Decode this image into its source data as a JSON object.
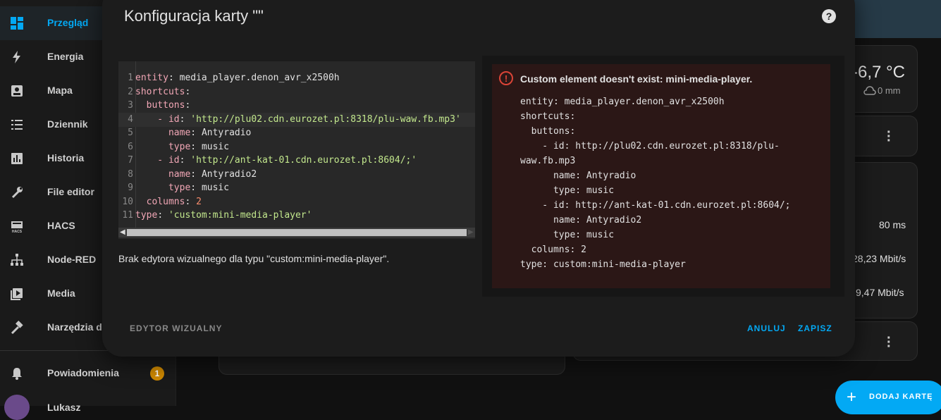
{
  "sidebar": {
    "items": [
      {
        "label": "Przegląd",
        "icon": "dashboard-icon"
      },
      {
        "label": "Energia",
        "icon": "lightning-icon"
      },
      {
        "label": "Mapa",
        "icon": "map-icon"
      },
      {
        "label": "Dziennik",
        "icon": "list-icon"
      },
      {
        "label": "Historia",
        "icon": "chart-icon"
      },
      {
        "label": "File editor",
        "icon": "wrench-icon"
      },
      {
        "label": "HACS",
        "icon": "hacs-icon"
      },
      {
        "label": "Node-RED",
        "icon": "sitemap-icon"
      },
      {
        "label": "Media",
        "icon": "play-icon"
      },
      {
        "label": "Narzędzia de",
        "icon": "hammer-icon"
      }
    ],
    "notifications": {
      "label": "Powiadomienia",
      "count": "1",
      "icon": "bell-icon"
    },
    "user": {
      "label": "Lukasz"
    }
  },
  "background": {
    "temperature": "-6,7 °C",
    "precipitation": "0 mm",
    "ping": "80 ms",
    "download": "28,23 Mbit/s",
    "upload": "9,47 Mbit/s",
    "add_card_label": "DODAJ KARTĘ"
  },
  "dialog": {
    "title": "Konfiguracja karty \"\"",
    "help_icon": "?",
    "editor_lines": [
      {
        "n": "1",
        "key": "entity",
        "val": "media_player.denon_avr_x2500h",
        "vtype": "t",
        "indent": ""
      },
      {
        "n": "2",
        "key": "shortcuts",
        "val": "",
        "vtype": "t",
        "indent": ""
      },
      {
        "n": "3",
        "key": "buttons",
        "val": "",
        "vtype": "t",
        "indent": "  "
      },
      {
        "n": "4",
        "key": "id",
        "val": "'http://plu02.cdn.eurozet.pl:8318/plu-waw.fb.mp3'",
        "vtype": "s",
        "indent": "    - "
      },
      {
        "n": "5",
        "key": "name",
        "val": "Antyradio",
        "vtype": "t",
        "indent": "      "
      },
      {
        "n": "6",
        "key": "type",
        "val": "music",
        "vtype": "t",
        "indent": "      "
      },
      {
        "n": "7",
        "key": "id",
        "val": "'http://ant-kat-01.cdn.eurozet.pl:8604/;'",
        "vtype": "s",
        "indent": "    - "
      },
      {
        "n": "8",
        "key": "name",
        "val": "Antyradio2",
        "vtype": "t",
        "indent": "      "
      },
      {
        "n": "9",
        "key": "type",
        "val": "music",
        "vtype": "t",
        "indent": "      "
      },
      {
        "n": "10",
        "key": "columns",
        "val": "2",
        "vtype": "n",
        "indent": "  "
      },
      {
        "n": "11",
        "key": "type",
        "val": "'custom:mini-media-player'",
        "vtype": "s",
        "indent": ""
      }
    ],
    "no_visual_editor": "Brak edytora wizualnego dla typu \"custom:mini-media-player\".",
    "error": {
      "title": "Custom element doesn't exist: mini-media-player.",
      "lines": [
        "entity: media_player.denon_avr_x2500h",
        "shortcuts:",
        "  buttons:",
        "    - id: http://plu02.cdn.eurozet.pl:8318/plu-",
        "waw.fb.mp3",
        "      name: Antyradio",
        "      type: music",
        "    - id: http://ant-kat-01.cdn.eurozet.pl:8604/;",
        "      name: Antyradio2",
        "      type: music",
        "  columns: 2",
        "type: custom:mini-media-player"
      ]
    },
    "buttons": {
      "visual_editor": "EDYTOR WIZUALNY",
      "cancel": "ANULUJ",
      "save": "ZAPISZ"
    }
  },
  "colors": {
    "accent": "#03a9f4",
    "error": "#db4437",
    "badge": "#d08a00"
  }
}
